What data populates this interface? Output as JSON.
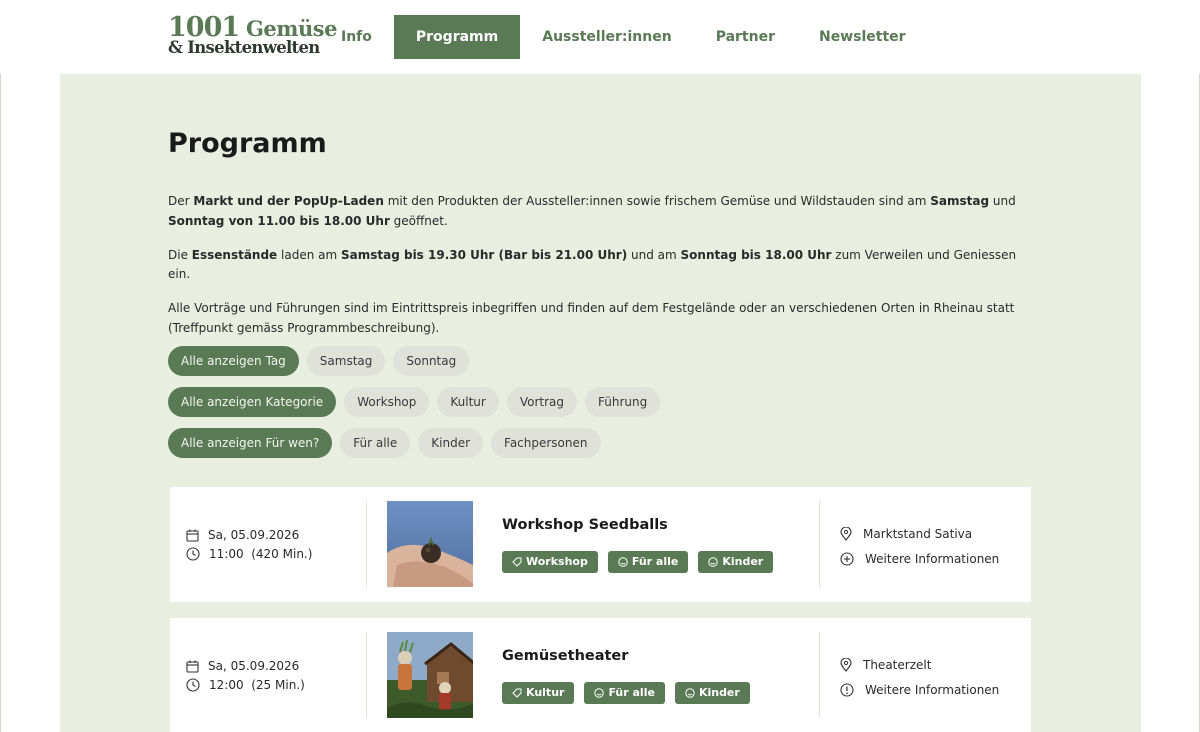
{
  "logo": {
    "line1_num": "1001",
    "line1_word": "Gemüse",
    "line2": "& Insektenwelten"
  },
  "nav": [
    {
      "label": "Info",
      "active": false
    },
    {
      "label": "Programm",
      "active": true
    },
    {
      "label": "Aussteller:innen",
      "active": false
    },
    {
      "label": "Partner",
      "active": false
    },
    {
      "label": "Newsletter",
      "active": false
    }
  ],
  "page": {
    "title": "Programm",
    "p1": {
      "a": "Der ",
      "b1": "Markt und der PopUp-Laden",
      "c": " mit den Produkten der Aussteller:innen sowie frischem Gemüse und Wildstauden sind am ",
      "b2": "Samstag",
      "d": " und ",
      "b3": "Sonntag von 11.00 bis 18.00 Uhr",
      "e": " geöffnet."
    },
    "p2": {
      "a": "Die ",
      "b1": "Essenstände",
      "c": " laden am ",
      "b2": "Samstag bis 19.30 Uhr (Bar bis 21.00 Uhr)",
      "d": " und am ",
      "b3": "Sonntag bis 18.00 Uhr",
      "e": " zum Verweilen und Geniessen ein."
    },
    "p3": "Alle Vorträge und Führungen sind im Eintrittspreis inbegriffen und finden auf dem Festgelände oder an verschiedenen Orten in Rheinau statt (Treffpunkt gemäss Programmbeschreibung)."
  },
  "filters": {
    "day": [
      "Alle anzeigen Tag",
      "Samstag",
      "Sonntag"
    ],
    "category": [
      "Alle anzeigen Kategorie",
      "Workshop",
      "Kultur",
      "Vortrag",
      "Führung"
    ],
    "audience": [
      "Alle anzeigen Für wen?",
      "Für alle",
      "Kinder",
      "Fachpersonen"
    ]
  },
  "events": [
    {
      "date": "Sa, 05.09.2026",
      "time": "11:00",
      "duration": "(420 Min.)",
      "title": "Workshop Seedballs",
      "tags": [
        "Workshop",
        "Für alle",
        "Kinder"
      ],
      "location": "Marktstand Sativa",
      "more": "Weitere Informationen"
    },
    {
      "date": "Sa, 05.09.2026",
      "time": "12:00",
      "duration": "(25 Min.)",
      "title": "Gemüsetheater",
      "tags": [
        "Kultur",
        "Für alle",
        "Kinder"
      ],
      "location": "Theaterzelt",
      "more": "Weitere Informationen"
    }
  ],
  "colors": {
    "accent": "#5a7a56",
    "background": "#e8efe1",
    "chip": "#e0e2da"
  }
}
